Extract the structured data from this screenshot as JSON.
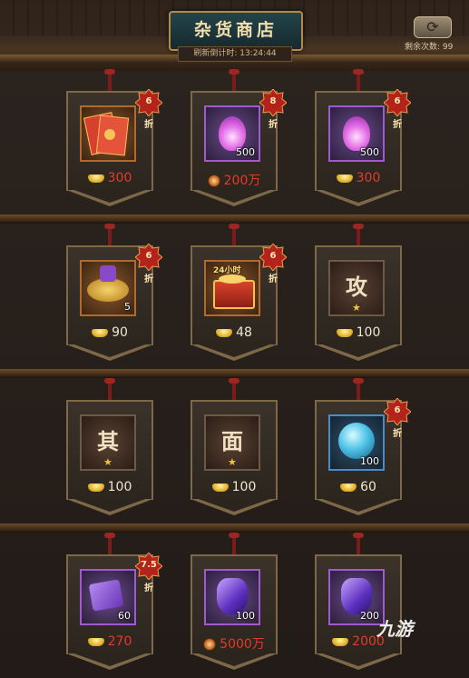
{
  "header": {
    "title": "杂货商店",
    "timer_label": "刷新倒计时: 13:24:44",
    "remain_label": "剩余次数: 99",
    "refresh_icon": "refresh-icon"
  },
  "items": [
    {
      "icon": "red-envelope-icon",
      "frame": "orange",
      "qty": "",
      "badge": [
        "6",
        "折"
      ],
      "price": "300",
      "currency": "ingot",
      "price_color": "red"
    },
    {
      "icon": "purple-flame-icon",
      "frame": "purple",
      "qty": "500",
      "badge": [
        "8",
        "折"
      ],
      "price": "200万",
      "currency": "copper",
      "price_color": "red"
    },
    {
      "icon": "purple-flame-icon",
      "frame": "purple",
      "qty": "500",
      "badge": [
        "6",
        "折"
      ],
      "price": "300",
      "currency": "ingot",
      "price_color": "red"
    },
    {
      "icon": "puzzle-loot-icon",
      "frame": "orange",
      "qty": "5",
      "badge": [
        "6",
        "折"
      ],
      "price": "90",
      "currency": "ingot",
      "price_color": "white"
    },
    {
      "icon": "treasure-chest-icon",
      "frame": "orange",
      "qty": "",
      "tag": "24小时",
      "badge": [
        "6",
        "折"
      ],
      "price": "48",
      "currency": "ingot",
      "price_color": "white"
    },
    {
      "icon": "rune-char-icon",
      "frame": "dark",
      "char": "攻",
      "star": true,
      "price": "100",
      "currency": "ingot",
      "price_color": "white"
    },
    {
      "icon": "rune-char-icon",
      "frame": "dark",
      "char": "其",
      "star": true,
      "price": "100",
      "currency": "ingot",
      "price_color": "white"
    },
    {
      "icon": "rune-char-icon",
      "frame": "dark",
      "char": "面",
      "star": true,
      "price": "100",
      "currency": "ingot",
      "price_color": "white"
    },
    {
      "icon": "blue-orb-icon",
      "frame": "blue",
      "qty": "100",
      "badge": [
        "6",
        "折"
      ],
      "price": "60",
      "currency": "ingot",
      "price_color": "white"
    },
    {
      "icon": "purple-puzzle-icon",
      "frame": "purple",
      "qty": "60",
      "badge": [
        "7.5",
        "折"
      ],
      "price": "270",
      "currency": "ingot",
      "price_color": "red"
    },
    {
      "icon": "purple-gem-icon",
      "frame": "purple",
      "qty": "100",
      "price": "5000万",
      "currency": "copper",
      "price_color": "red"
    },
    {
      "icon": "purple-gem-icon",
      "frame": "purple",
      "qty": "200",
      "price": "2000",
      "currency": "ingot",
      "price_color": "red"
    }
  ],
  "watermark": "九游"
}
